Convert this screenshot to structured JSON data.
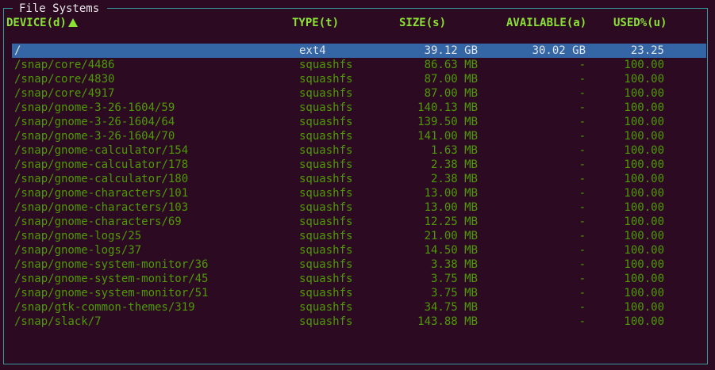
{
  "window": {
    "title": "File Systems"
  },
  "columns": {
    "device": "DEVICE(d)",
    "type": "TYPE(t)",
    "size": "SIZE(s)",
    "available": "AVAILABLE(a)",
    "used": "USED%(u)"
  },
  "sort": {
    "column": "device",
    "direction": "ascending",
    "indicator": "up-triangle-icon"
  },
  "colors": {
    "background": "#2c0a22",
    "border": "#34989c",
    "text": "#4e9a06",
    "header": "#8ae234",
    "selection": "#3465a4"
  },
  "rows": [
    {
      "device": "/",
      "type": "ext4",
      "size": "39.12 GB",
      "available": "30.02 GB",
      "used": "23.25",
      "selected": true
    },
    {
      "device": "/snap/core/4486",
      "type": "squashfs",
      "size": "86.63 MB",
      "available": "-",
      "used": "100.00"
    },
    {
      "device": "/snap/core/4830",
      "type": "squashfs",
      "size": "87.00 MB",
      "available": "-",
      "used": "100.00"
    },
    {
      "device": "/snap/core/4917",
      "type": "squashfs",
      "size": "87.00 MB",
      "available": "-",
      "used": "100.00"
    },
    {
      "device": "/snap/gnome-3-26-1604/59",
      "type": "squashfs",
      "size": "140.13 MB",
      "available": "-",
      "used": "100.00"
    },
    {
      "device": "/snap/gnome-3-26-1604/64",
      "type": "squashfs",
      "size": "139.50 MB",
      "available": "-",
      "used": "100.00"
    },
    {
      "device": "/snap/gnome-3-26-1604/70",
      "type": "squashfs",
      "size": "141.00 MB",
      "available": "-",
      "used": "100.00"
    },
    {
      "device": "/snap/gnome-calculator/154",
      "type": "squashfs",
      "size": "1.63 MB",
      "available": "-",
      "used": "100.00"
    },
    {
      "device": "/snap/gnome-calculator/178",
      "type": "squashfs",
      "size": "2.38 MB",
      "available": "-",
      "used": "100.00"
    },
    {
      "device": "/snap/gnome-calculator/180",
      "type": "squashfs",
      "size": "2.38 MB",
      "available": "-",
      "used": "100.00"
    },
    {
      "device": "/snap/gnome-characters/101",
      "type": "squashfs",
      "size": "13.00 MB",
      "available": "-",
      "used": "100.00"
    },
    {
      "device": "/snap/gnome-characters/103",
      "type": "squashfs",
      "size": "13.00 MB",
      "available": "-",
      "used": "100.00"
    },
    {
      "device": "/snap/gnome-characters/69",
      "type": "squashfs",
      "size": "12.25 MB",
      "available": "-",
      "used": "100.00"
    },
    {
      "device": "/snap/gnome-logs/25",
      "type": "squashfs",
      "size": "21.00 MB",
      "available": "-",
      "used": "100.00"
    },
    {
      "device": "/snap/gnome-logs/37",
      "type": "squashfs",
      "size": "14.50 MB",
      "available": "-",
      "used": "100.00"
    },
    {
      "device": "/snap/gnome-system-monitor/36",
      "type": "squashfs",
      "size": "3.38 MB",
      "available": "-",
      "used": "100.00"
    },
    {
      "device": "/snap/gnome-system-monitor/45",
      "type": "squashfs",
      "size": "3.75 MB",
      "available": "-",
      "used": "100.00"
    },
    {
      "device": "/snap/gnome-system-monitor/51",
      "type": "squashfs",
      "size": "3.75 MB",
      "available": "-",
      "used": "100.00"
    },
    {
      "device": "/snap/gtk-common-themes/319",
      "type": "squashfs",
      "size": "34.75 MB",
      "available": "-",
      "used": "100.00"
    },
    {
      "device": "/snap/slack/7",
      "type": "squashfs",
      "size": "143.88 MB",
      "available": "-",
      "used": "100.00"
    }
  ]
}
